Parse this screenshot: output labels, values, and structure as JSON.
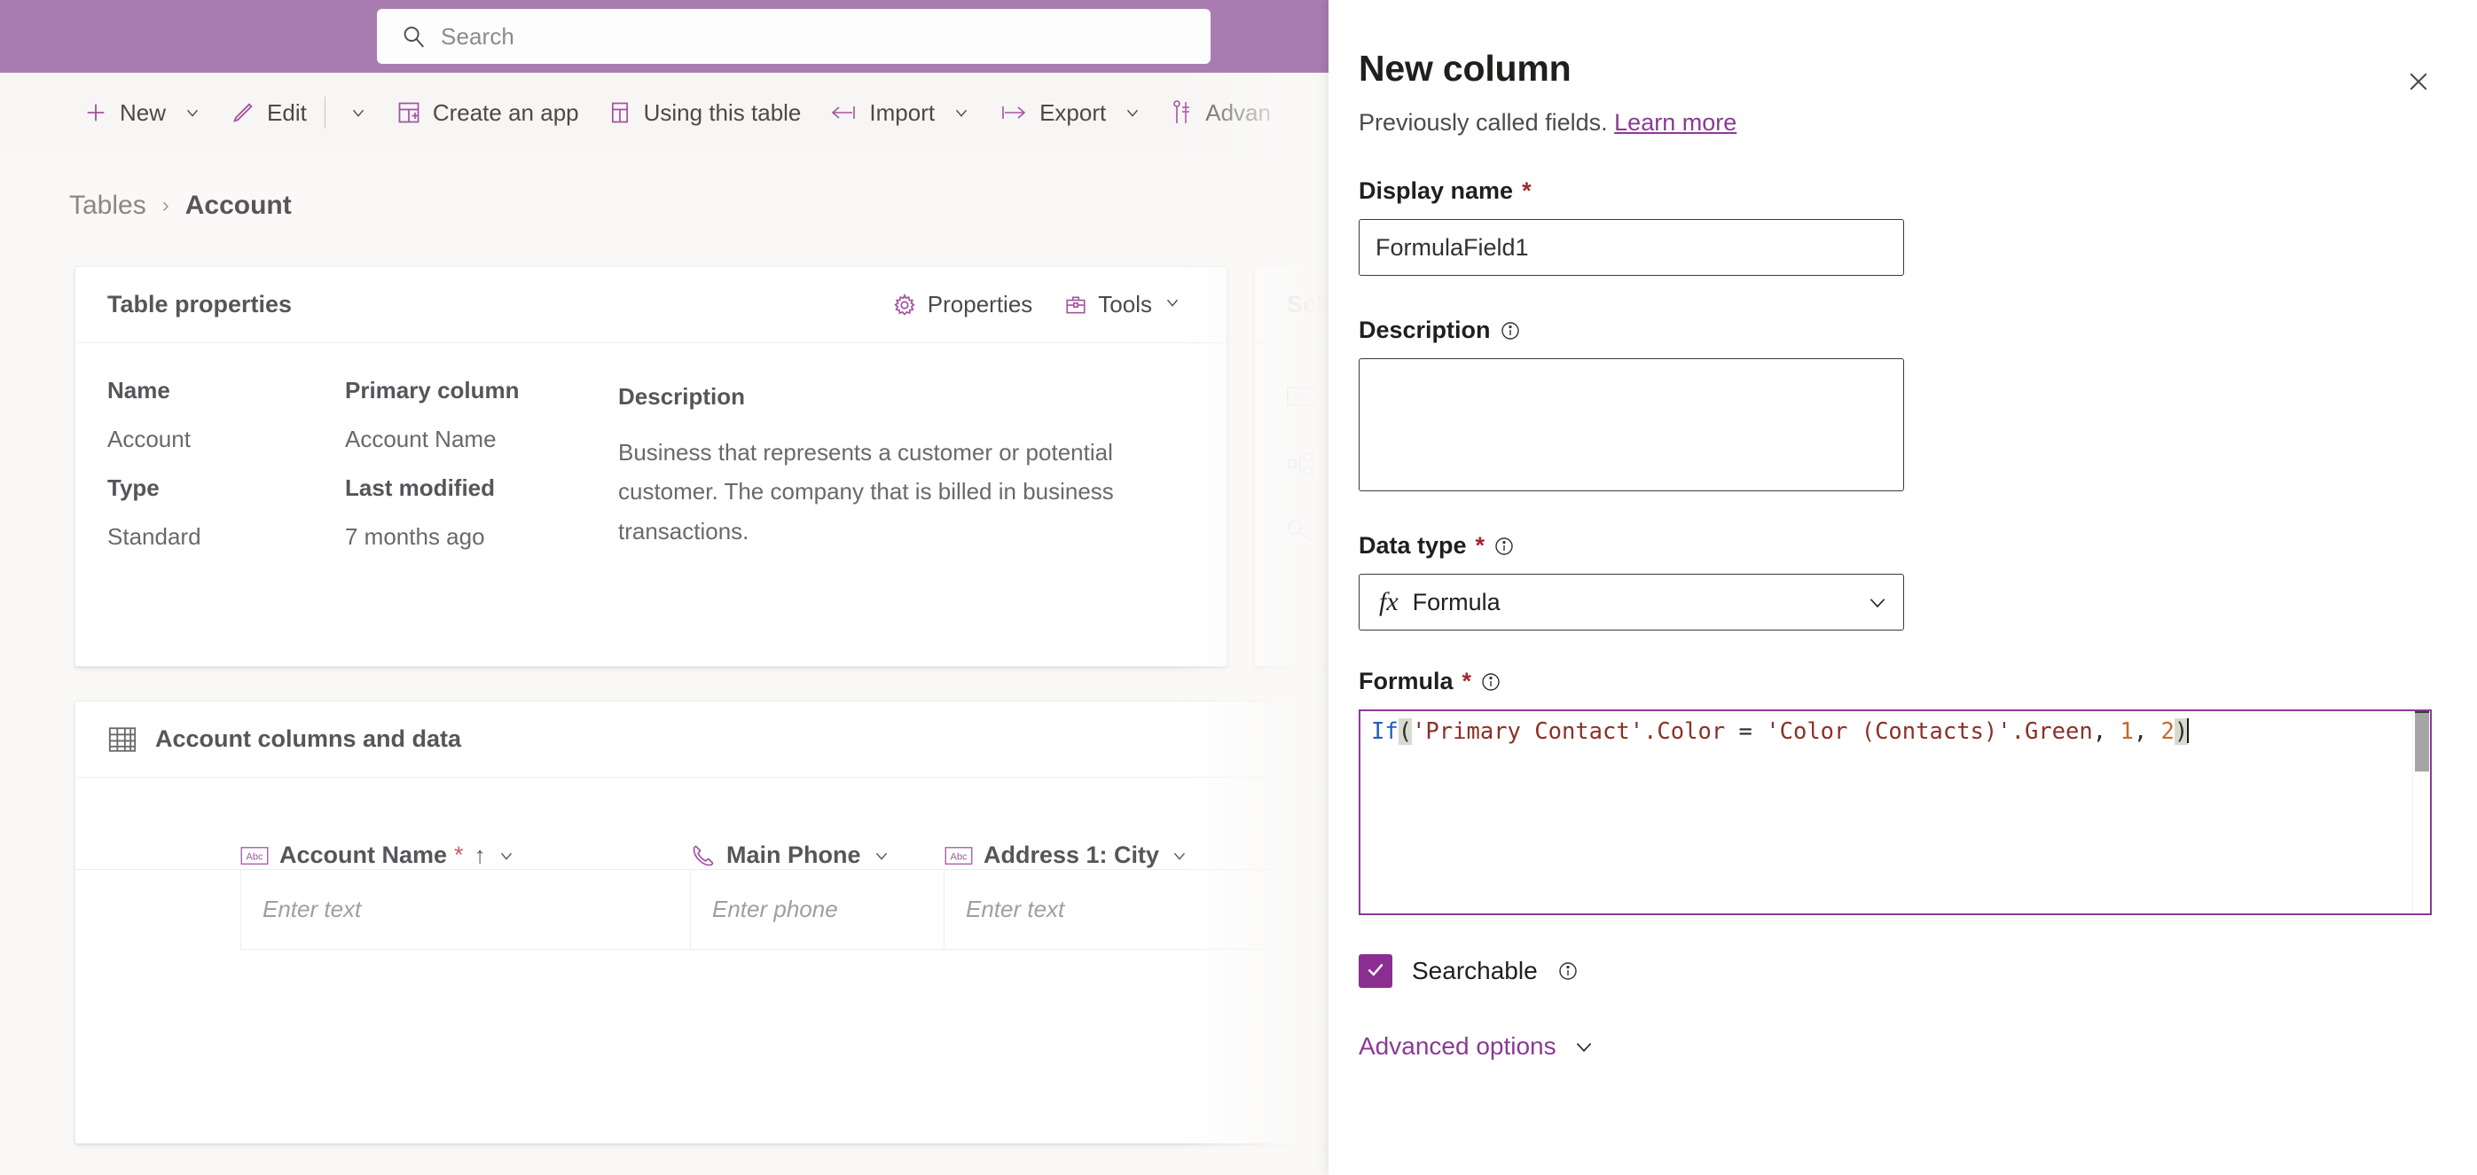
{
  "topbar": {
    "search": {
      "icon": "search-icon",
      "placeholder": "Search"
    },
    "bg_color": "#a87cb0"
  },
  "commandbar": {
    "items": [
      {
        "label": "New",
        "icon": "plus-icon",
        "has_chevron": true
      },
      {
        "label": "Edit",
        "icon": "pencil-icon",
        "has_chevron": true
      },
      {
        "label": "Create an app",
        "icon": "create-app-icon",
        "has_chevron": false
      },
      {
        "label": "Using this table",
        "icon": "table-layout-icon",
        "has_chevron": false
      },
      {
        "label": "Import",
        "icon": "import-arrow-icon",
        "has_chevron": true
      },
      {
        "label": "Export",
        "icon": "export-arrow-icon",
        "has_chevron": true
      },
      {
        "label": "Advan",
        "icon": "advanced-tools-icon",
        "has_chevron": false
      }
    ]
  },
  "breadcrumb": {
    "parent": "Tables",
    "separator": "›",
    "current": "Account"
  },
  "table_properties": {
    "title": "Table properties",
    "actions": [
      {
        "label": "Properties",
        "icon": "gear-icon"
      },
      {
        "label": "Tools",
        "icon": "toolbox-icon",
        "has_chevron": true
      }
    ],
    "headers": {
      "name": "Name",
      "primary_column": "Primary column",
      "description": "Description"
    },
    "row1": {
      "name": "Account",
      "primary_column": "Account Name"
    },
    "headers2": {
      "type": "Type",
      "last_modified": "Last modified"
    },
    "row2": {
      "type": "Standard",
      "last_modified": "7 months ago"
    },
    "description_text": "Business that represents a customer or potential customer. The company that is billed in business transactions."
  },
  "schema_card": {
    "title": "Sche",
    "rows": [
      {
        "icon": "abc-text-icon",
        "label": ""
      },
      {
        "icon": "relationships-icon",
        "label": ""
      },
      {
        "icon": "key-icon",
        "label": ""
      }
    ]
  },
  "columns_card": {
    "title": "Account columns and data",
    "icon": "grid-table-icon",
    "columns": [
      {
        "label": "Account Name",
        "icon": "abc-text-icon",
        "required": "*",
        "sorted": "↑",
        "has_chevron": true
      },
      {
        "label": "Main Phone",
        "icon": "phone-icon",
        "required": "",
        "sorted": "",
        "has_chevron": true
      },
      {
        "label": "Address 1: City",
        "icon": "abc-text-icon",
        "required": "",
        "sorted": "",
        "has_chevron": true
      }
    ],
    "row_placeholders": [
      "Enter text",
      "Enter phone",
      "Enter text",
      ""
    ]
  },
  "panel": {
    "title": "New column",
    "subtitle_text": "Previously called fields.",
    "learn_more": "Learn more",
    "close_icon": "close-icon",
    "accent_color": "#8a3a96",
    "display_name": {
      "label": "Display name",
      "required": "*",
      "value": "FormulaField1"
    },
    "description": {
      "label": "Description",
      "info_icon": "info-icon",
      "value": ""
    },
    "data_type": {
      "label": "Data type",
      "required": "*",
      "info_icon": "info-icon",
      "icon": "fx-icon",
      "value": "Formula",
      "chevron_icon": "chevron-down-icon"
    },
    "formula": {
      "label": "Formula",
      "required": "*",
      "info_icon": "info-icon",
      "text": "If('Primary Contact'.Color = 'Color (Contacts)'.Green, 1, 2)",
      "tokens": [
        {
          "t": "If",
          "c": "fn"
        },
        {
          "t": "(",
          "c": "match"
        },
        {
          "t": "'Primary Contact'",
          "c": "str"
        },
        {
          "t": ".Color",
          "c": "str"
        },
        {
          "t": " = ",
          "c": "op"
        },
        {
          "t": "'Color (Contacts)'",
          "c": "str"
        },
        {
          "t": ".Green",
          "c": "str"
        },
        {
          "t": ",",
          "c": "punc"
        },
        {
          "t": " 1",
          "c": "num"
        },
        {
          "t": ",",
          "c": "punc"
        },
        {
          "t": " 2",
          "c": "num"
        },
        {
          "t": ")",
          "c": "match"
        }
      ]
    },
    "searchable": {
      "label": "Searchable",
      "checked": true,
      "info_icon": "info-icon",
      "check_icon": "check-icon"
    },
    "advanced_options": {
      "label": "Advanced options",
      "chevron_icon": "chevron-down-icon"
    }
  }
}
